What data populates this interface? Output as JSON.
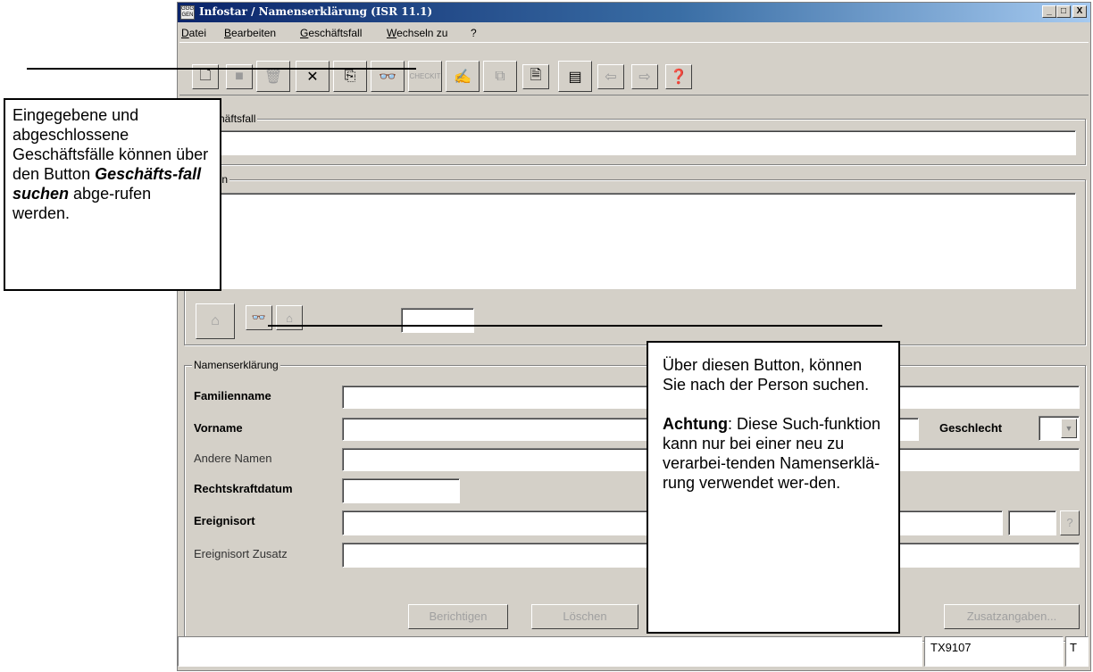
{
  "window": {
    "title": "Infostar / Namenserklärung (ISR 11.1)",
    "app_icon_text": "GGG GEN",
    "controls": [
      "_",
      "□",
      "X"
    ]
  },
  "menu": [
    "Datei",
    "Bearbeiten",
    "Geschäftsfall",
    "Wechseln zu",
    "?"
  ],
  "toolbar": {
    "icons": [
      "new-icon",
      "save-icon",
      "trash-icon",
      "delete-icon",
      "import-icon",
      "binoculars-icon",
      "check-icon",
      "sign-icon",
      "copy-icon",
      "document-icon",
      "preview-icon",
      "back-arrow-icon",
      "forward-arrow-icon",
      "help-icon"
    ],
    "check_text": "CHECKIT"
  },
  "groups": {
    "geschaeftsfall": "Geschäftsfall",
    "person": "Person",
    "namenserklaerung": "Namenserklärung"
  },
  "form": {
    "familienname": "Familienname",
    "vorname": "Vorname",
    "geschlecht": "Geschlecht",
    "andere_namen": "Andere Namen",
    "rechtskraftdatum": "Rechtskraftdatum",
    "ereignisort": "Ereignisort",
    "ereignisort_zusatz": "Ereignisort Zusatz",
    "help_button": "?"
  },
  "buttons": {
    "berichtigen": "Berichtigen",
    "loeschen": "Löschen",
    "zusatzangaben": "Zusatzangaben..."
  },
  "statusbar": {
    "code": "TX9107",
    "flag": "T"
  },
  "callouts": {
    "left": {
      "line1": "Eingegebene und abgeschlossene Geschäftsfälle können über den Button ",
      "bold_italic": "Geschäfts-fall suchen",
      "line2": " abge-rufen werden."
    },
    "right": {
      "para1": "Über diesen Button, können Sie nach der Person suchen.",
      "bold": "Achtung",
      "para2": ": Diese Such-funktion kann nur bei einer neu zu verarbei-tenden Namenserklä-rung verwendet wer-den."
    }
  }
}
